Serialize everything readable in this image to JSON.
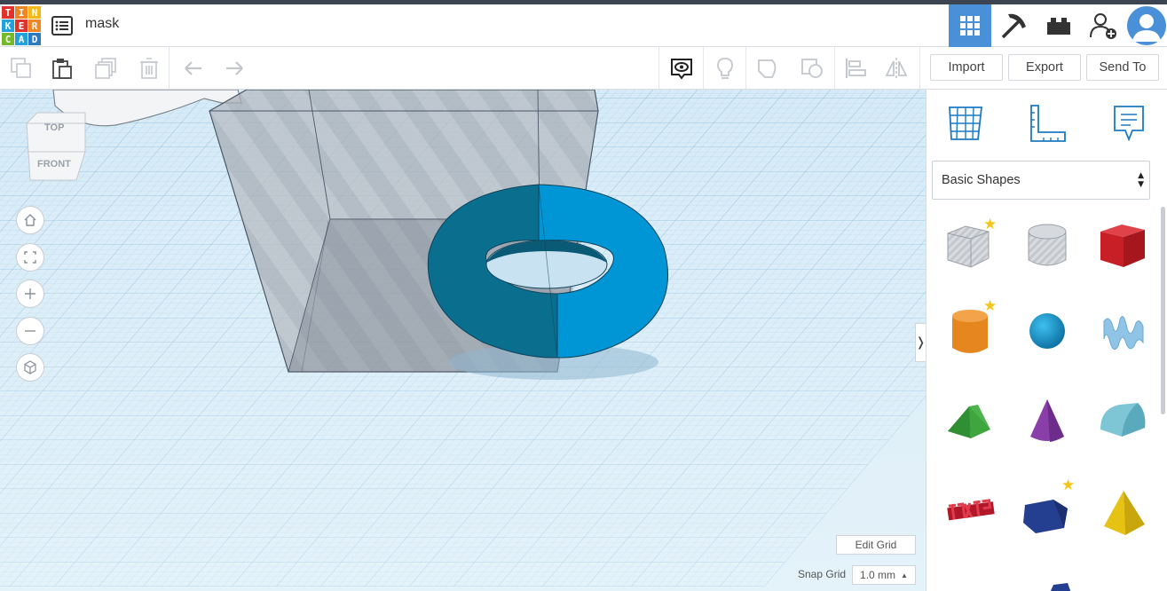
{
  "app": {
    "logo_letters": [
      "T",
      "I",
      "N",
      "K",
      "E",
      "R",
      "C",
      "A",
      "D"
    ],
    "logo_colors": [
      "#e2312b",
      "#f08623",
      "#f4b917",
      "#22a2dc",
      "#e2312b",
      "#f08623",
      "#76b82a",
      "#22a2dc",
      "#2e7ac1"
    ],
    "project_title": "mask"
  },
  "header": {
    "icons": [
      "grid-view-icon",
      "pickaxe-icon",
      "bricks-icon",
      "add-user-icon",
      "avatar"
    ],
    "active_color": "#4a90d9"
  },
  "toolbar": {
    "import_label": "Import",
    "export_label": "Export",
    "send_to_label": "Send To"
  },
  "viewcube": {
    "top_label": "TOP",
    "front_label": "FRONT"
  },
  "grid_controls": {
    "edit_grid_label": "Edit Grid",
    "snap_grid_label": "Snap Grid",
    "snap_grid_value": "1.0 mm"
  },
  "panel": {
    "category_selected": "Basic Shapes",
    "collapse_glyph": "❭",
    "shapes": [
      {
        "name": "box-hole",
        "favorite": true
      },
      {
        "name": "cylinder-hole",
        "favorite": false
      },
      {
        "name": "box",
        "favorite": false
      },
      {
        "name": "cylinder",
        "favorite": true
      },
      {
        "name": "sphere",
        "favorite": false
      },
      {
        "name": "scribble",
        "favorite": false
      },
      {
        "name": "roof",
        "favorite": false
      },
      {
        "name": "cone",
        "favorite": false
      },
      {
        "name": "round-roof",
        "favorite": false
      },
      {
        "name": "text",
        "favorite": false
      },
      {
        "name": "polygon",
        "favorite": true
      },
      {
        "name": "pyramid",
        "favorite": false
      }
    ]
  },
  "colors": {
    "torus_dark": "#0a6e8f",
    "torus_light": "#0096d6",
    "grid_bg": "#cfe6f5",
    "hole_gray": "#b8bcc2"
  }
}
